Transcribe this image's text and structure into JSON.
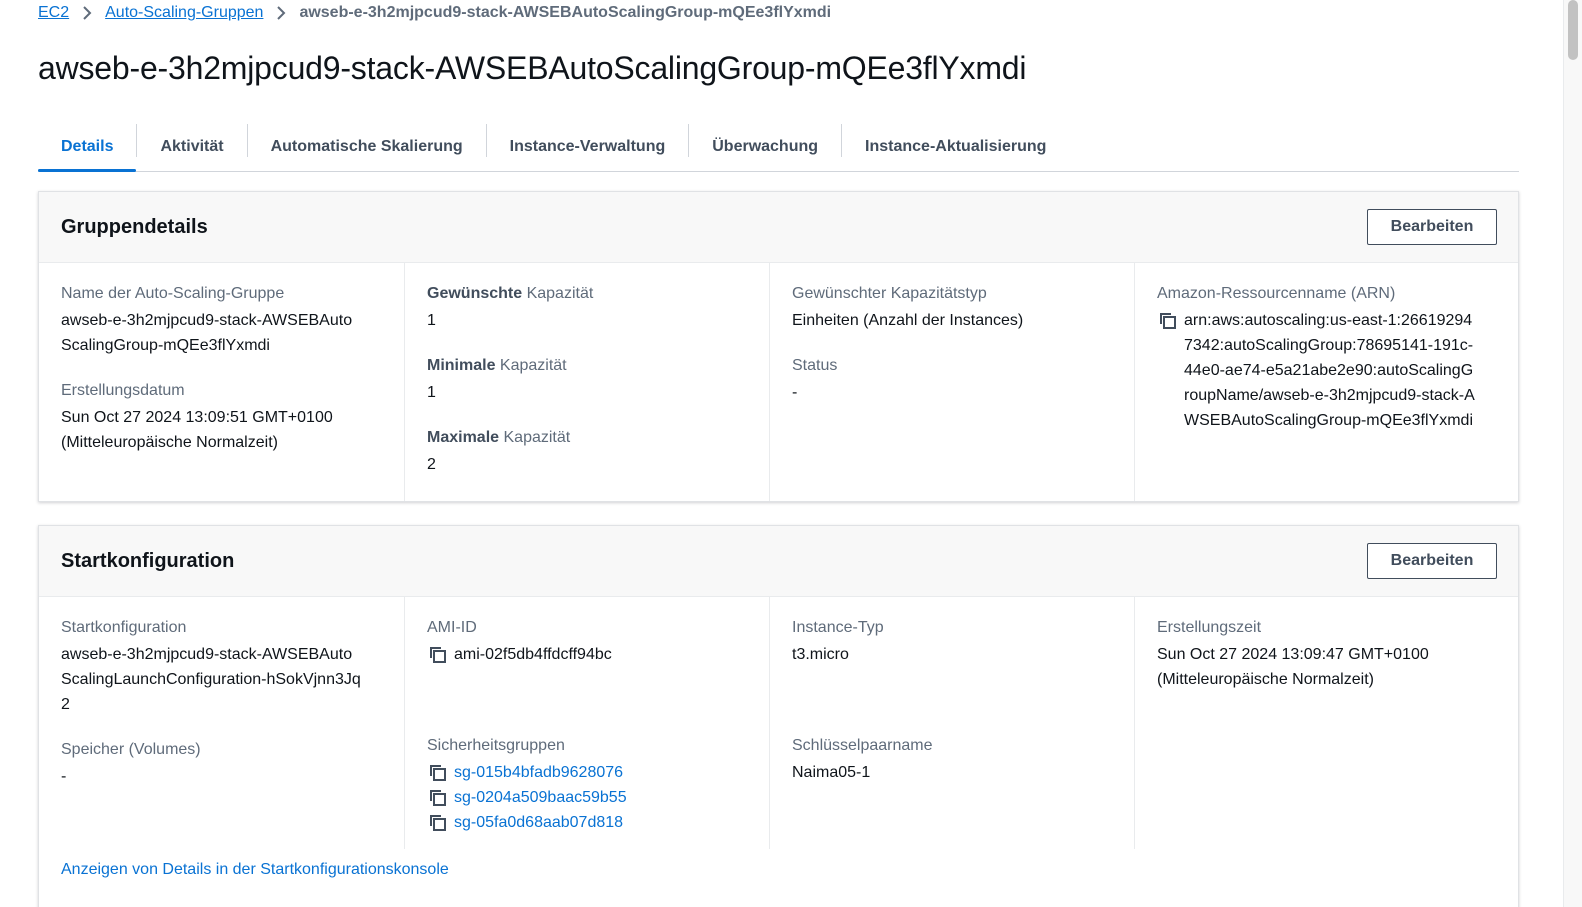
{
  "breadcrumb": {
    "items": [
      "EC2",
      "Auto-Scaling-Gruppen"
    ],
    "current": "awseb-e-3h2mjpcud9-stack-AWSEBAutoScalingGroup-mQEe3flYxmdi"
  },
  "page_title": "awseb-e-3h2mjpcud9-stack-AWSEBAutoScalingGroup-mQEe3flYxmdi",
  "tabs": [
    {
      "label": "Details"
    },
    {
      "label": "Aktivität"
    },
    {
      "label": "Automatische Skalierung"
    },
    {
      "label": "Instance-Verwaltung"
    },
    {
      "label": "Überwachung"
    },
    {
      "label": "Instance-Aktualisierung"
    }
  ],
  "active_tab": "Details",
  "group_details": {
    "title": "Gruppendetails",
    "edit_label": "Bearbeiten",
    "asg_name": {
      "label": "Name der Auto-Scaling-Gruppe",
      "value": "awseb-e-3h2mjpcud9-stack-AWSEBAutoScalingGroup-mQEe3flYxmdi"
    },
    "created": {
      "label": "Erstellungsdatum",
      "value": "Sun Oct 27 2024 13:09:51 GMT+0100 (Mitteleuropäische Normalzeit)"
    },
    "desired": {
      "label_bold": "Gewünschte",
      "label_rest": " Kapazität",
      "value": "1"
    },
    "minimum": {
      "label_bold": "Minimale",
      "label_rest": " Kapazität",
      "value": "1"
    },
    "maximum": {
      "label_bold": "Maximale",
      "label_rest": " Kapazität",
      "value": "2"
    },
    "capacity_type": {
      "label": "Gewünschter Kapazitätstyp",
      "value": "Einheiten (Anzahl der Instances)"
    },
    "status": {
      "label": "Status",
      "value": "-"
    },
    "arn": {
      "label": "Amazon-Ressourcenname (ARN)",
      "value": "arn:aws:autoscaling:us-east-1:266192947342:autoScalingGroup:78695141-191c-44e0-ae74-e5a21abe2e90:autoScalingGroupName/awseb-e-3h2mjpcud9-stack-AWSEBAutoScalingGroup-mQEe3flYxmdi"
    }
  },
  "launch_config": {
    "title": "Startkonfiguration",
    "edit_label": "Bearbeiten",
    "config": {
      "label": "Startkonfiguration",
      "value": "awseb-e-3h2mjpcud9-stack-AWSEBAutoScalingLaunchConfiguration-hSokVjnn3Jq2"
    },
    "volumes": {
      "label": "Speicher (Volumes)",
      "value": "-"
    },
    "ami": {
      "label": "AMI-ID",
      "value": "ami-02f5db4ffdcff94bc"
    },
    "security_groups": {
      "label": "Sicherheitsgruppen",
      "items": [
        "sg-015b4bfadb9628076",
        "sg-0204a509baac59b55",
        "sg-05fa0d68aab07d818"
      ]
    },
    "instance_type": {
      "label": "Instance-Typ",
      "value": "t3.micro"
    },
    "key_pair": {
      "label": "Schlüsselpaarname",
      "value": "Naima05-1"
    },
    "created_time": {
      "label": "Erstellungszeit",
      "value": "Sun Oct 27 2024 13:09:47 GMT+0100 (Mitteleuropäische Normalzeit)"
    },
    "console_link": "Anzeigen von Details in der Startkonfigurationskonsole"
  },
  "colors": {
    "link": "#0972d3",
    "text": "#0f141a",
    "label": "#5f6b7a",
    "border": "#e9ebed"
  },
  "icons": {
    "separator": "chevron-right-icon",
    "copy": "copy-icon"
  }
}
